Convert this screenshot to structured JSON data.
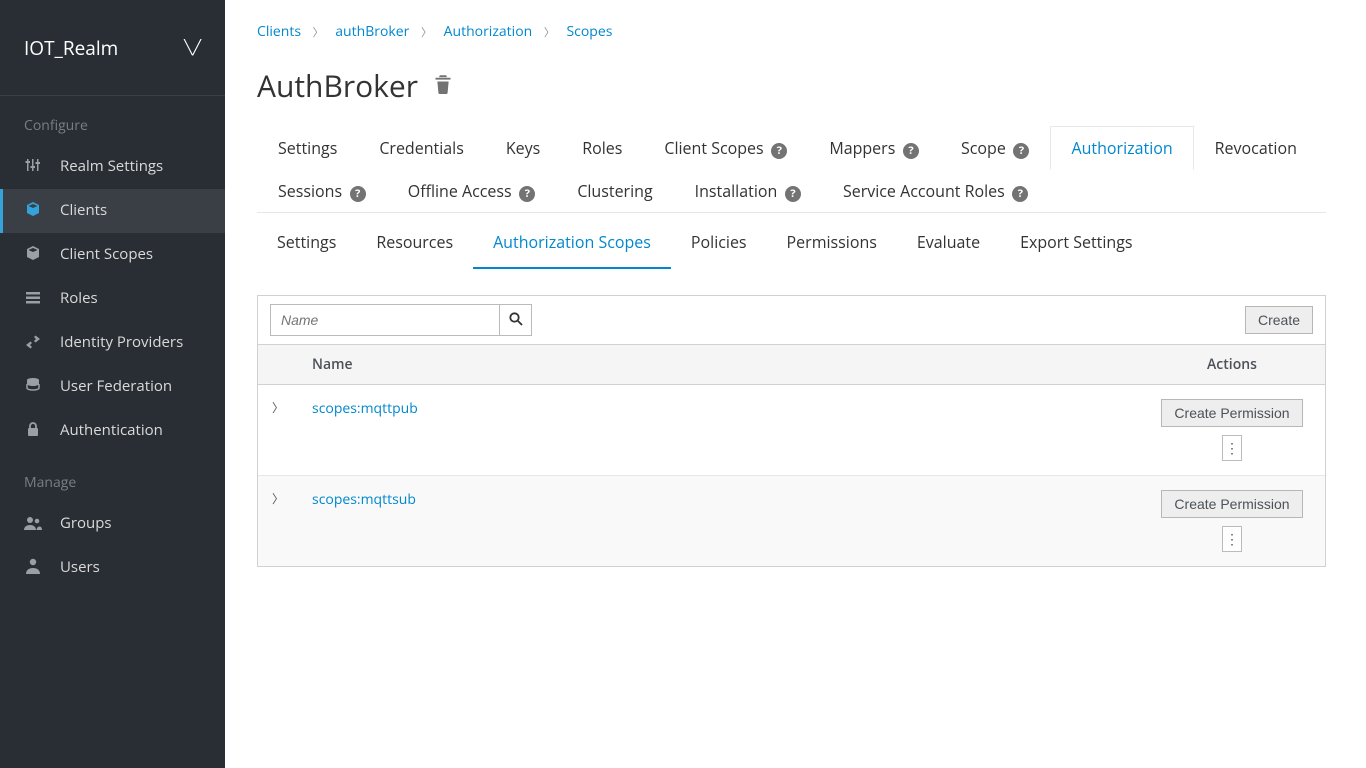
{
  "realm": "IOT_Realm",
  "sidebar": {
    "section_configure": "Configure",
    "section_manage": "Manage",
    "items_configure": [
      {
        "label": "Realm Settings",
        "icon": "sliders-icon"
      },
      {
        "label": "Clients",
        "icon": "cube-icon"
      },
      {
        "label": "Client Scopes",
        "icon": "cube-icon"
      },
      {
        "label": "Roles",
        "icon": "stack-icon"
      },
      {
        "label": "Identity Providers",
        "icon": "exchange-icon"
      },
      {
        "label": "User Federation",
        "icon": "db-icon"
      },
      {
        "label": "Authentication",
        "icon": "lock-icon"
      }
    ],
    "items_manage": [
      {
        "label": "Groups",
        "icon": "users-icon"
      },
      {
        "label": "Users",
        "icon": "user-icon"
      }
    ]
  },
  "breadcrumb": {
    "items": [
      "Clients",
      "authBroker",
      "Authorization",
      "Scopes"
    ]
  },
  "page_title": "AuthBroker",
  "tabs_main": [
    {
      "label": "Settings",
      "help": false
    },
    {
      "label": "Credentials",
      "help": false
    },
    {
      "label": "Keys",
      "help": false
    },
    {
      "label": "Roles",
      "help": false
    },
    {
      "label": "Client Scopes",
      "help": true
    },
    {
      "label": "Mappers",
      "help": true
    },
    {
      "label": "Scope",
      "help": true
    },
    {
      "label": "Authorization",
      "help": false,
      "active": true
    },
    {
      "label": "Revocation",
      "help": false
    },
    {
      "label": "Sessions",
      "help": true
    },
    {
      "label": "Offline Access",
      "help": true
    },
    {
      "label": "Clustering",
      "help": false
    },
    {
      "label": "Installation",
      "help": true
    },
    {
      "label": "Service Account Roles",
      "help": true
    }
  ],
  "tabs_sub": [
    {
      "label": "Settings"
    },
    {
      "label": "Resources"
    },
    {
      "label": "Authorization Scopes",
      "active": true
    },
    {
      "label": "Policies"
    },
    {
      "label": "Permissions"
    },
    {
      "label": "Evaluate"
    },
    {
      "label": "Export Settings"
    }
  ],
  "table": {
    "search_placeholder": "Name",
    "create_label": "Create",
    "col_name": "Name",
    "col_actions": "Actions",
    "create_permission_label": "Create Permission",
    "rows": [
      {
        "name": "scopes:mqttpub"
      },
      {
        "name": "scopes:mqttsub"
      }
    ]
  }
}
